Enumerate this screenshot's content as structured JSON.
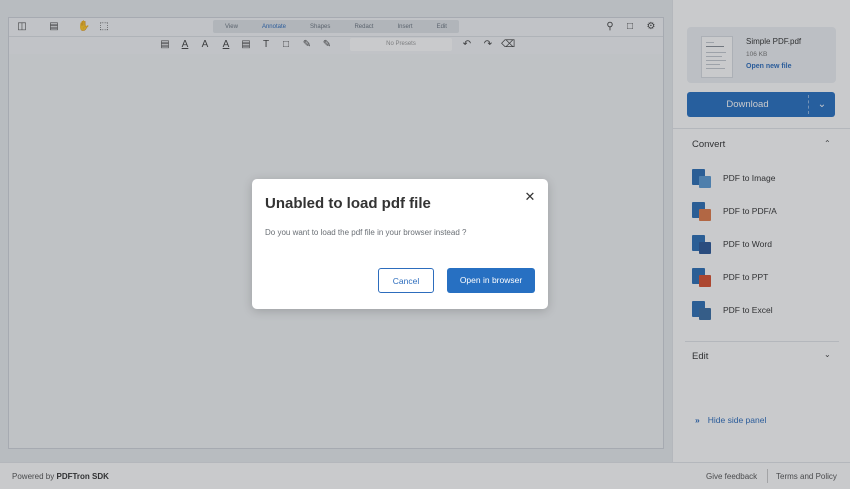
{
  "toolbar": {
    "tabs": [
      "View",
      "Annotate",
      "Shapes",
      "Redact",
      "Insert",
      "Edit"
    ],
    "active_tab": "Annotate",
    "presets_label": "No Presets"
  },
  "sidebar": {
    "file": {
      "name": "Simple PDF.pdf",
      "size": "106 KB",
      "open_new": "Open new file"
    },
    "download_label": "Download",
    "convert": {
      "heading": "Convert",
      "items": [
        {
          "label": "PDF to Image",
          "accent": "#5b9bd5"
        },
        {
          "label": "PDF to PDF/A",
          "accent": "#e07b4a"
        },
        {
          "label": "PDF to Word",
          "accent": "#2b5797"
        },
        {
          "label": "PDF to PPT",
          "accent": "#d9502f"
        },
        {
          "label": "PDF to Excel",
          "accent": "#3a6ea5"
        }
      ]
    },
    "edit": {
      "heading": "Edit"
    },
    "hide_label": "Hide side panel"
  },
  "dialog": {
    "title": "Unabled to load pdf file",
    "message": "Do you want to  load the pdf file in your browser instead ?",
    "cancel_label": "Cancel",
    "open_label": "Open in browser"
  },
  "footer": {
    "powered_prefix": "Powered by",
    "powered_brand": "PDFTron SDK",
    "feedback": "Give feedback",
    "terms": "Terms and Policy"
  },
  "colors": {
    "accent": "#2770c2",
    "link": "#2d6dbd"
  }
}
